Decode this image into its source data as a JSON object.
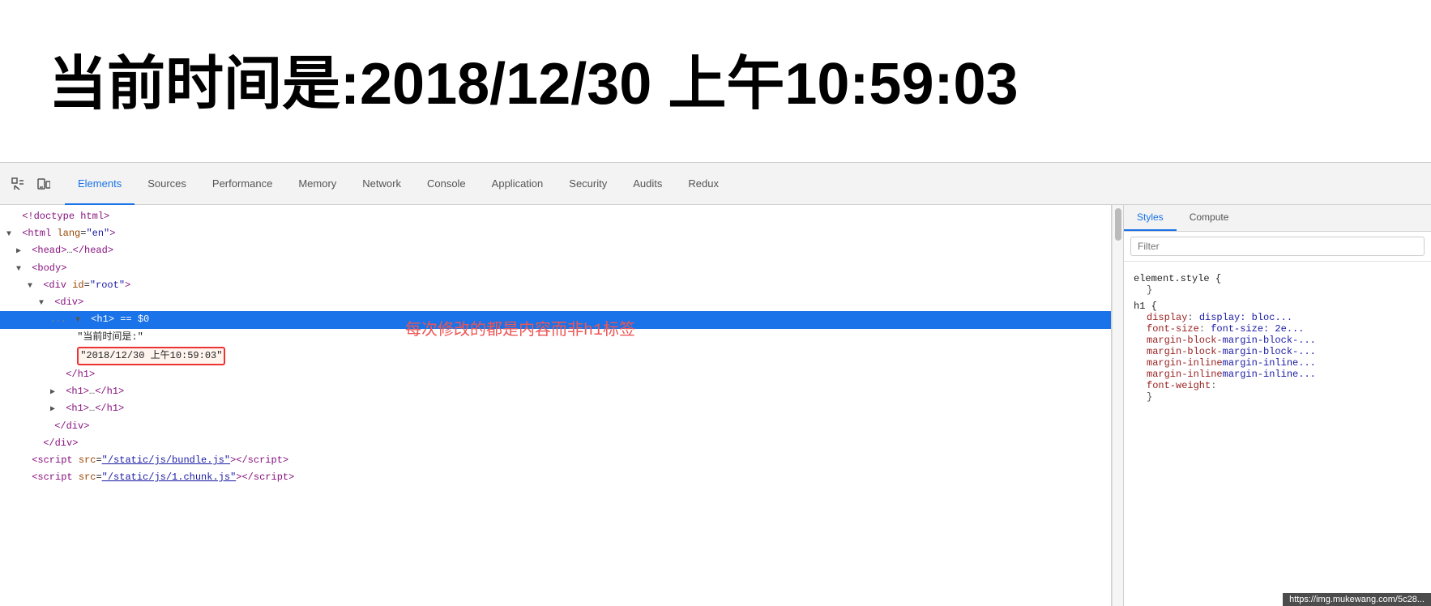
{
  "page": {
    "title": "当前时间是:2018/12/30 上午10:59:03"
  },
  "devtools": {
    "tabs": [
      {
        "label": "Elements",
        "active": true
      },
      {
        "label": "Sources",
        "active": false
      },
      {
        "label": "Performance",
        "active": false
      },
      {
        "label": "Memory",
        "active": false
      },
      {
        "label": "Network",
        "active": false
      },
      {
        "label": "Console",
        "active": false
      },
      {
        "label": "Application",
        "active": false
      },
      {
        "label": "Security",
        "active": false
      },
      {
        "label": "Audits",
        "active": false
      },
      {
        "label": "Redux",
        "active": false
      }
    ],
    "styles_tabs": [
      {
        "label": "Styles",
        "active": true
      },
      {
        "label": "Computed",
        "active": false
      }
    ],
    "filter_placeholder": "Filter",
    "annotation": "每次修改的都是内容而非h1标签",
    "tooltip": "https://img.mukewang.com/5c28...",
    "style_rules": {
      "element_style": "element.style {",
      "element_close": "}",
      "h1_selector": "h1 {",
      "h1_display": "display: bloc...",
      "h1_font_size": "font-size: 2e...",
      "h1_margin_block_start": "margin-block-...",
      "h1_margin_block_end": "margin-block-...",
      "h1_margin_inline_start": "margin-inline...",
      "h1_margin_inline_end": "margin-inline...",
      "h1_font_weight": "font-weight:",
      "h1_close": "}"
    }
  }
}
